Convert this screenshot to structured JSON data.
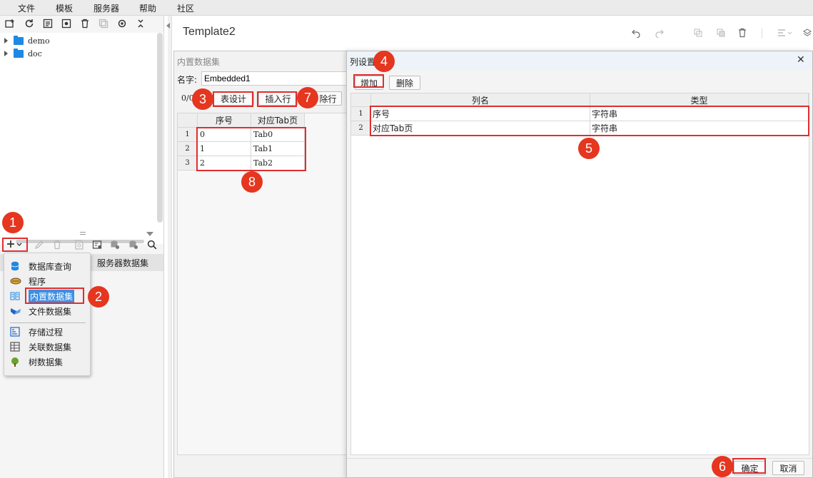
{
  "menubar": {
    "items": [
      "文件",
      "模板",
      "服务器",
      "帮助",
      "社区"
    ]
  },
  "tree": {
    "items": [
      "demo",
      "doc"
    ]
  },
  "dataset_panel": {
    "tab_label": "服务器数据集"
  },
  "add_menu": {
    "items": [
      {
        "label": "数据库查询",
        "icon": "database-icon"
      },
      {
        "label": "程序",
        "icon": "program-icon"
      },
      {
        "label": "内置数据集",
        "icon": "embedded-dataset-icon"
      },
      {
        "label": "文件数据集",
        "icon": "file-dataset-icon"
      },
      {
        "label": "存储过程",
        "icon": "stored-procedure-icon"
      },
      {
        "label": "关联数据集",
        "icon": "related-dataset-icon"
      },
      {
        "label": "树数据集",
        "icon": "tree-dataset-icon"
      }
    ]
  },
  "template": {
    "title": "Template2"
  },
  "embedded_dialog": {
    "title": "内置数据集",
    "name_label": "名字:",
    "name_value": "Embedded1",
    "counter": "0/0",
    "btn_table_design": "表设计",
    "btn_insert_row": "插入行",
    "btn_delete_row": "除行",
    "columns": [
      "序号",
      "对应Tab页"
    ],
    "rows": [
      {
        "num": "1",
        "cells": [
          "0",
          "Tab0"
        ]
      },
      {
        "num": "2",
        "cells": [
          "1",
          "Tab1"
        ]
      },
      {
        "num": "3",
        "cells": [
          "2",
          "Tab2"
        ]
      }
    ]
  },
  "column_dialog": {
    "title": "列设置",
    "btn_add": "增加",
    "btn_delete": "删除",
    "columns": [
      "列名",
      "类型"
    ],
    "rows": [
      {
        "num": "1",
        "cells": [
          "序号",
          "字符串"
        ]
      },
      {
        "num": "2",
        "cells": [
          "对应Tab页",
          "字符串"
        ]
      }
    ],
    "btn_ok": "确定",
    "btn_cancel": "取消",
    "close_glyph": "✕"
  },
  "badges": [
    "1",
    "2",
    "3",
    "4",
    "5",
    "6",
    "7",
    "8"
  ],
  "colors": {
    "accent_red": "#e02e2e",
    "badge_red": "#e5361f",
    "highlight_blue": "#3d8fe0",
    "folder_blue": "#1e88e5"
  }
}
